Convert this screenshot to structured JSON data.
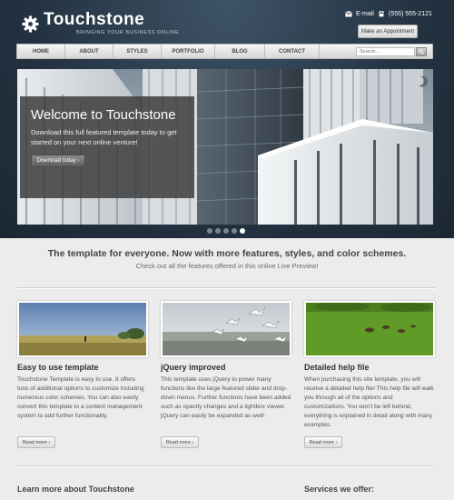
{
  "brand": {
    "name": "Touchstone",
    "tagline": "BRINGING YOUR BUSINESS ONLINE"
  },
  "header": {
    "email_label": "E-mail",
    "phone": "(555) 555-2121",
    "appointment_label": "Make an Appointment"
  },
  "nav": {
    "items": [
      "HOME",
      "ABOUT",
      "STYLES",
      "PORTFOLIO",
      "BLOG",
      "CONTACT"
    ],
    "search_placeholder": "Search..."
  },
  "slider": {
    "title": "Welcome to Touchstone",
    "text": "Download this full featured template today to get started on your next online venture!",
    "button_label": "Download today ›",
    "slide_count": 5,
    "active_slide": 5
  },
  "intro": {
    "heading": "The template for everyone. Now with more features, styles, and color schemes.",
    "subtext": "Check out all the features offered in this online Live Preview!"
  },
  "features": [
    {
      "title": "Easy to use template",
      "text": "Touchstone Template is easy to use. It offers tons of additional options to customize including numerous color schemes. You can also easily convert this template to a content management system to add further functionality.",
      "button_label": "Read more ›"
    },
    {
      "title": "jQuery improved",
      "text": "This template uses jQuery to power many functions like the large featured slider and drop-down menus. Further functions have been added such as opacity changes and a lightbox viewer. jQuery can easily be expanded as well!",
      "button_label": "Read more ›"
    },
    {
      "title": "Detailed help file",
      "text": "When purchasing this site template, you will receive a detailed help file! This help file will walk you through all of the options and customizations. You won't be left behind, everything is explained in detail along with many examples.",
      "button_label": "Read more ›"
    }
  ],
  "bottom": {
    "left_heading": "Learn more about Touchstone",
    "right_heading": "Services we offer:"
  },
  "colors": {
    "header_bg": "#233241",
    "page_bg": "#ececec",
    "caption_bg": "#3e3e3e"
  }
}
